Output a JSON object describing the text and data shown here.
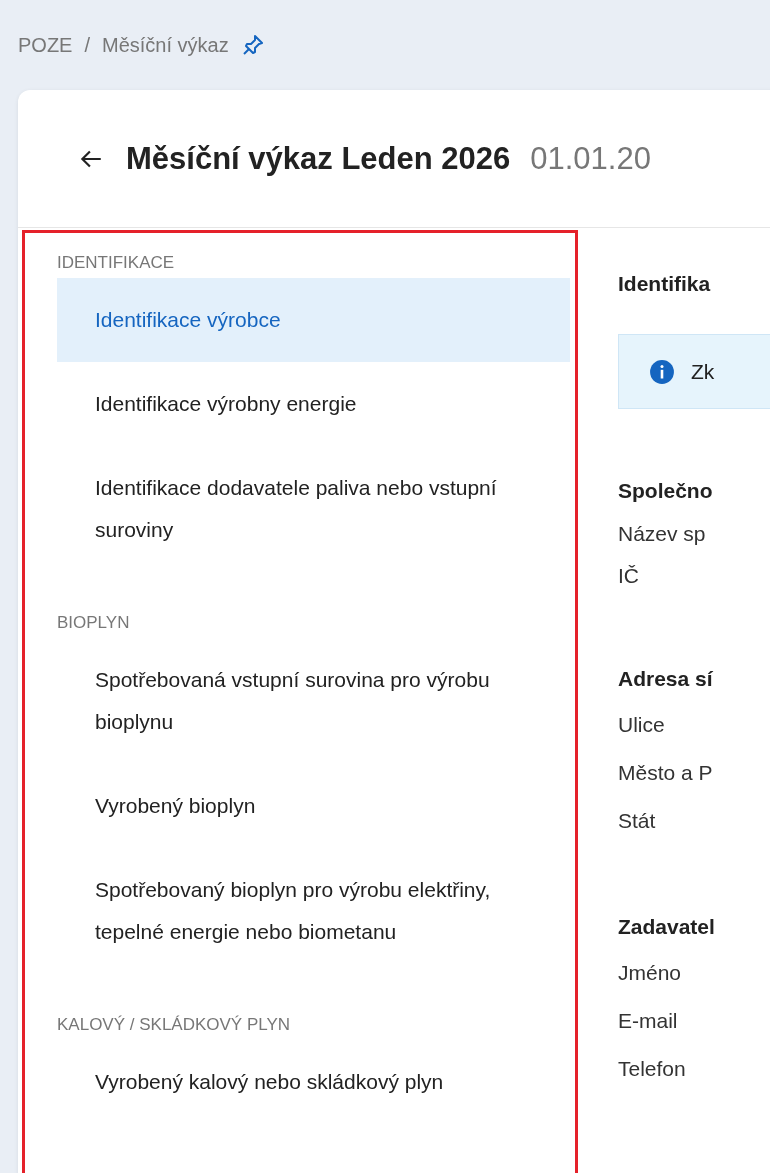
{
  "breadcrumb": {
    "items": [
      "POZE",
      "Měsíční výkaz"
    ],
    "separator": "/"
  },
  "header": {
    "title": "Měsíční výkaz Leden 2026",
    "date": "01.01.20"
  },
  "sidebar": {
    "sections": [
      {
        "label": "IDENTIFIKACE",
        "items": [
          {
            "label": "Identifikace výrobce",
            "selected": true
          },
          {
            "label": "Identifikace výrobny energie",
            "selected": false
          },
          {
            "label": "Identifikace dodavatele paliva nebo vstupní suroviny",
            "selected": false
          }
        ]
      },
      {
        "label": "BIOPLYN",
        "items": [
          {
            "label": "Spotřebovaná vstupní surovina pro výrobu bioplynu",
            "selected": false
          },
          {
            "label": "Vyrobený bioplyn",
            "selected": false
          },
          {
            "label": "Spotřebovaný bioplyn pro výrobu elektřiny, tepelné energie nebo biometanu",
            "selected": false
          }
        ]
      },
      {
        "label": "KALOVÝ / SKLÁDKOVÝ PLYN",
        "items": [
          {
            "label": "Vyrobený kalový nebo skládkový plyn",
            "selected": false
          }
        ]
      }
    ]
  },
  "detail": {
    "title": "Identifika",
    "notice": "Zk",
    "groups": [
      {
        "heading": "Společno",
        "fields": [
          "Název sp",
          "IČ"
        ]
      },
      {
        "heading": "Adresa sí",
        "fields": [
          "Ulice",
          "Město a P",
          "Stát"
        ]
      },
      {
        "heading": "Zadavatel",
        "fields": [
          "Jméno",
          "E-mail",
          "Telefon"
        ]
      }
    ]
  }
}
